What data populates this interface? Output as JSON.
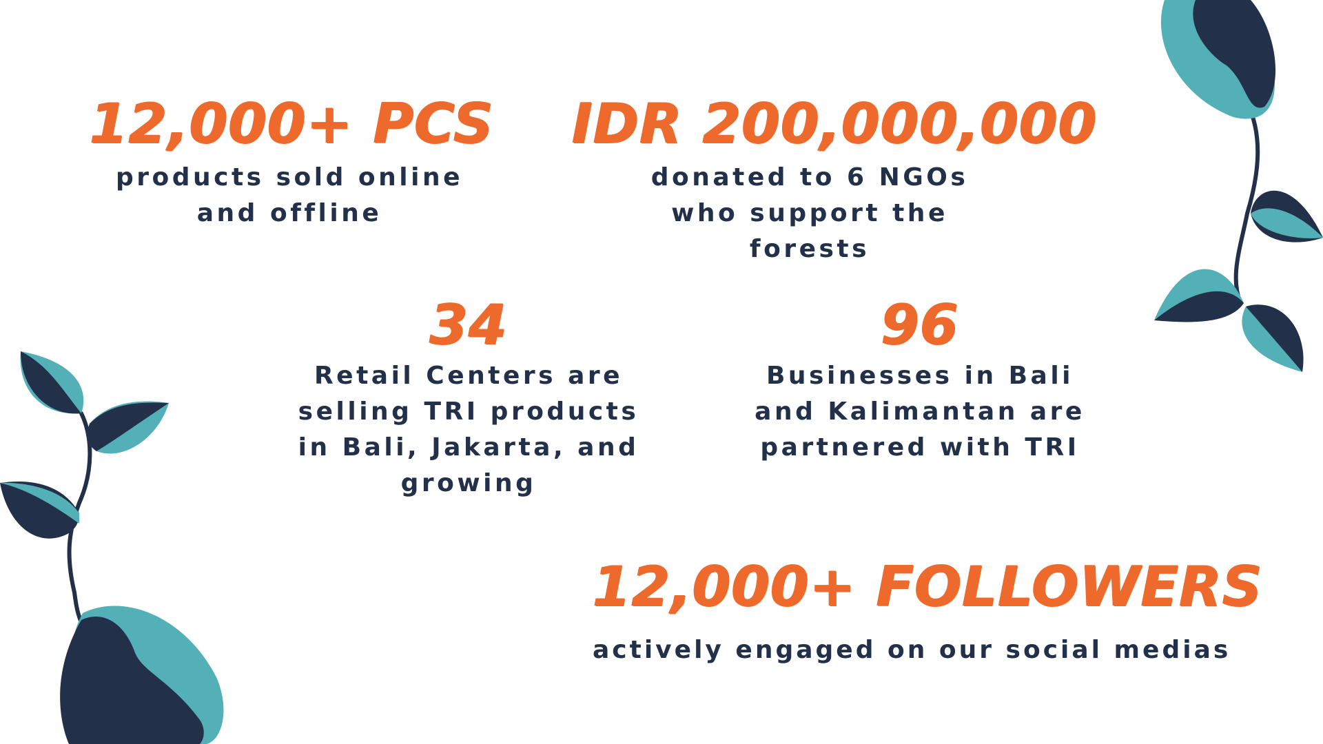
{
  "colors": {
    "accent": "#ee6a2c",
    "text": "#22304a",
    "leaf_dark": "#22304a",
    "leaf_teal": "#52b0b6",
    "background": "#ffffff"
  },
  "stats": [
    {
      "number": "12,000+ PCS",
      "caption": "products sold online and offline"
    },
    {
      "number": "IDR 200,000,000",
      "caption": "donated to 6 NGOs who support the forests"
    },
    {
      "number": "34",
      "caption": "Retail Centers are selling TRI products in Bali, Jakarta, and growing"
    },
    {
      "number": "96",
      "caption": "Businesses in Bali and Kalimantan are partnered with TRI"
    },
    {
      "number": "12,000+ FOLLOWERS",
      "caption": "actively engaged on our social medias"
    }
  ],
  "decorations": {
    "top_right": "leafy-vine-icon",
    "bottom_left": "leafy-vine-icon"
  }
}
